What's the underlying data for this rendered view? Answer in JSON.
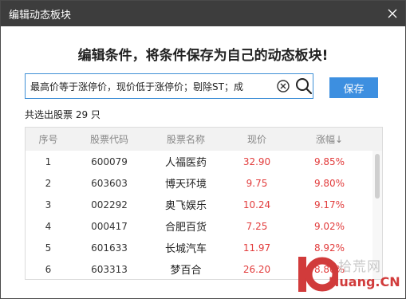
{
  "window": {
    "title": "编辑动态板块"
  },
  "heading": "编辑条件，将条件保存为自己的动态板块!",
  "search": {
    "value": "最高价等于涨停价，现价低于涨停价；剔除ST；成"
  },
  "save_label": "保存",
  "count_text": "共选出股票 29 只",
  "table": {
    "headers": [
      "序号",
      "股票代码",
      "股票名称",
      "现价",
      "涨幅↓"
    ],
    "rows": [
      [
        "1",
        "600079",
        "人福医药",
        "32.90",
        "9.85%"
      ],
      [
        "2",
        "603603",
        "博天环境",
        "9.75",
        "9.80%"
      ],
      [
        "3",
        "002292",
        "奥飞娱乐",
        "10.24",
        "9.17%"
      ],
      [
        "4",
        "000417",
        "合肥百货",
        "7.25",
        "9.02%"
      ],
      [
        "5",
        "601633",
        "长城汽车",
        "11.97",
        "8.92%"
      ],
      [
        "6",
        "603313",
        "梦百合",
        "26.20",
        "8.80%"
      ]
    ]
  },
  "watermark": {
    "logo": "10",
    "cn": "拾荒网",
    "en": "Huang.CN"
  },
  "colors": {
    "accent": "#3d8fe0",
    "price": "#e23c3c",
    "titlebar": "#3d3d3d"
  }
}
